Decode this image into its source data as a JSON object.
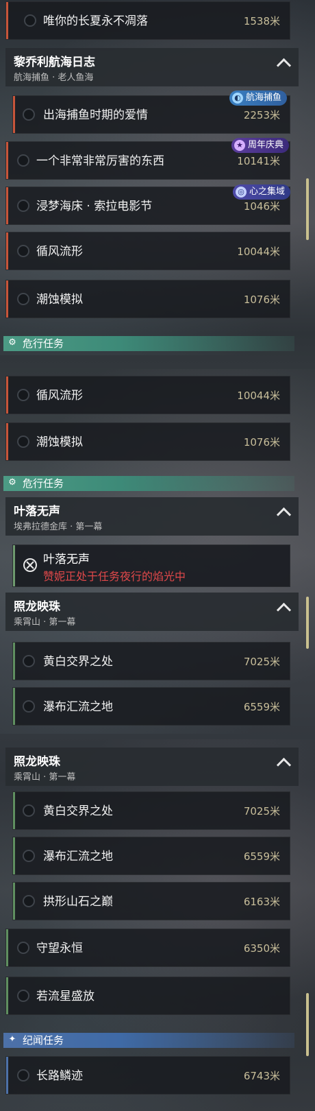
{
  "colors": {
    "red": "#c7553a",
    "green": "#5f8f60",
    "accent": "#c9bf9b",
    "danger": "#e0484a"
  },
  "seg1": {
    "row_top": {
      "title": "唯你的长夏永不凋落",
      "dist": "1538米"
    },
    "group": {
      "title": "黎乔利航海日志",
      "subtitle": "航海捕鱼 · 老人鱼海"
    },
    "rows": [
      {
        "title": "出海捕鱼时期的爱情",
        "dist": "2253米"
      },
      {
        "title": "一个非常非常厉害的东西",
        "dist": "10141米"
      },
      {
        "title": "浸梦海床 · 索拉电影节",
        "dist": "1046米"
      },
      {
        "title": "循风流形",
        "dist": "10044米"
      },
      {
        "title": "潮蚀模拟",
        "dist": "1076米"
      }
    ],
    "badges": [
      {
        "label": "航海捕鱼",
        "icon": "fish-icon"
      },
      {
        "label": "周年庆典",
        "icon": "anniversary-icon"
      },
      {
        "label": "心之集域",
        "icon": "swirl-icon"
      }
    ],
    "section": "危行任务"
  },
  "seg2": {
    "rows": [
      {
        "title": "循风流形",
        "dist": "10044米"
      },
      {
        "title": "潮蚀模拟",
        "dist": "1076米"
      }
    ],
    "section": "危行任务",
    "group1": {
      "title": "叶落无声",
      "subtitle": "埃弗拉德金库 · 第一幕"
    },
    "alert": {
      "title": "叶落无声",
      "message": "赞妮正处于任务夜行的焰光中"
    },
    "group2": {
      "title": "照龙映珠",
      "subtitle": "乘霄山 · 第一幕"
    },
    "rows2": [
      {
        "title": "黄白交界之处",
        "dist": "7025米"
      },
      {
        "title": "瀑布汇流之地",
        "dist": "6559米"
      }
    ]
  },
  "seg3": {
    "group": {
      "title": "照龙映珠",
      "subtitle": "乘霄山 · 第一幕"
    },
    "rows": [
      {
        "title": "黄白交界之处",
        "dist": "7025米"
      },
      {
        "title": "瀑布汇流之地",
        "dist": "6559米"
      },
      {
        "title": "拱形山石之巅",
        "dist": "6163米"
      }
    ],
    "rows2": [
      {
        "title": "守望永恒",
        "dist": "6350米"
      },
      {
        "title": "若流星盛放",
        "dist": ""
      }
    ],
    "section": "纪闻任务",
    "last": {
      "title": "长路鳞迹",
      "dist": "6743米"
    }
  }
}
